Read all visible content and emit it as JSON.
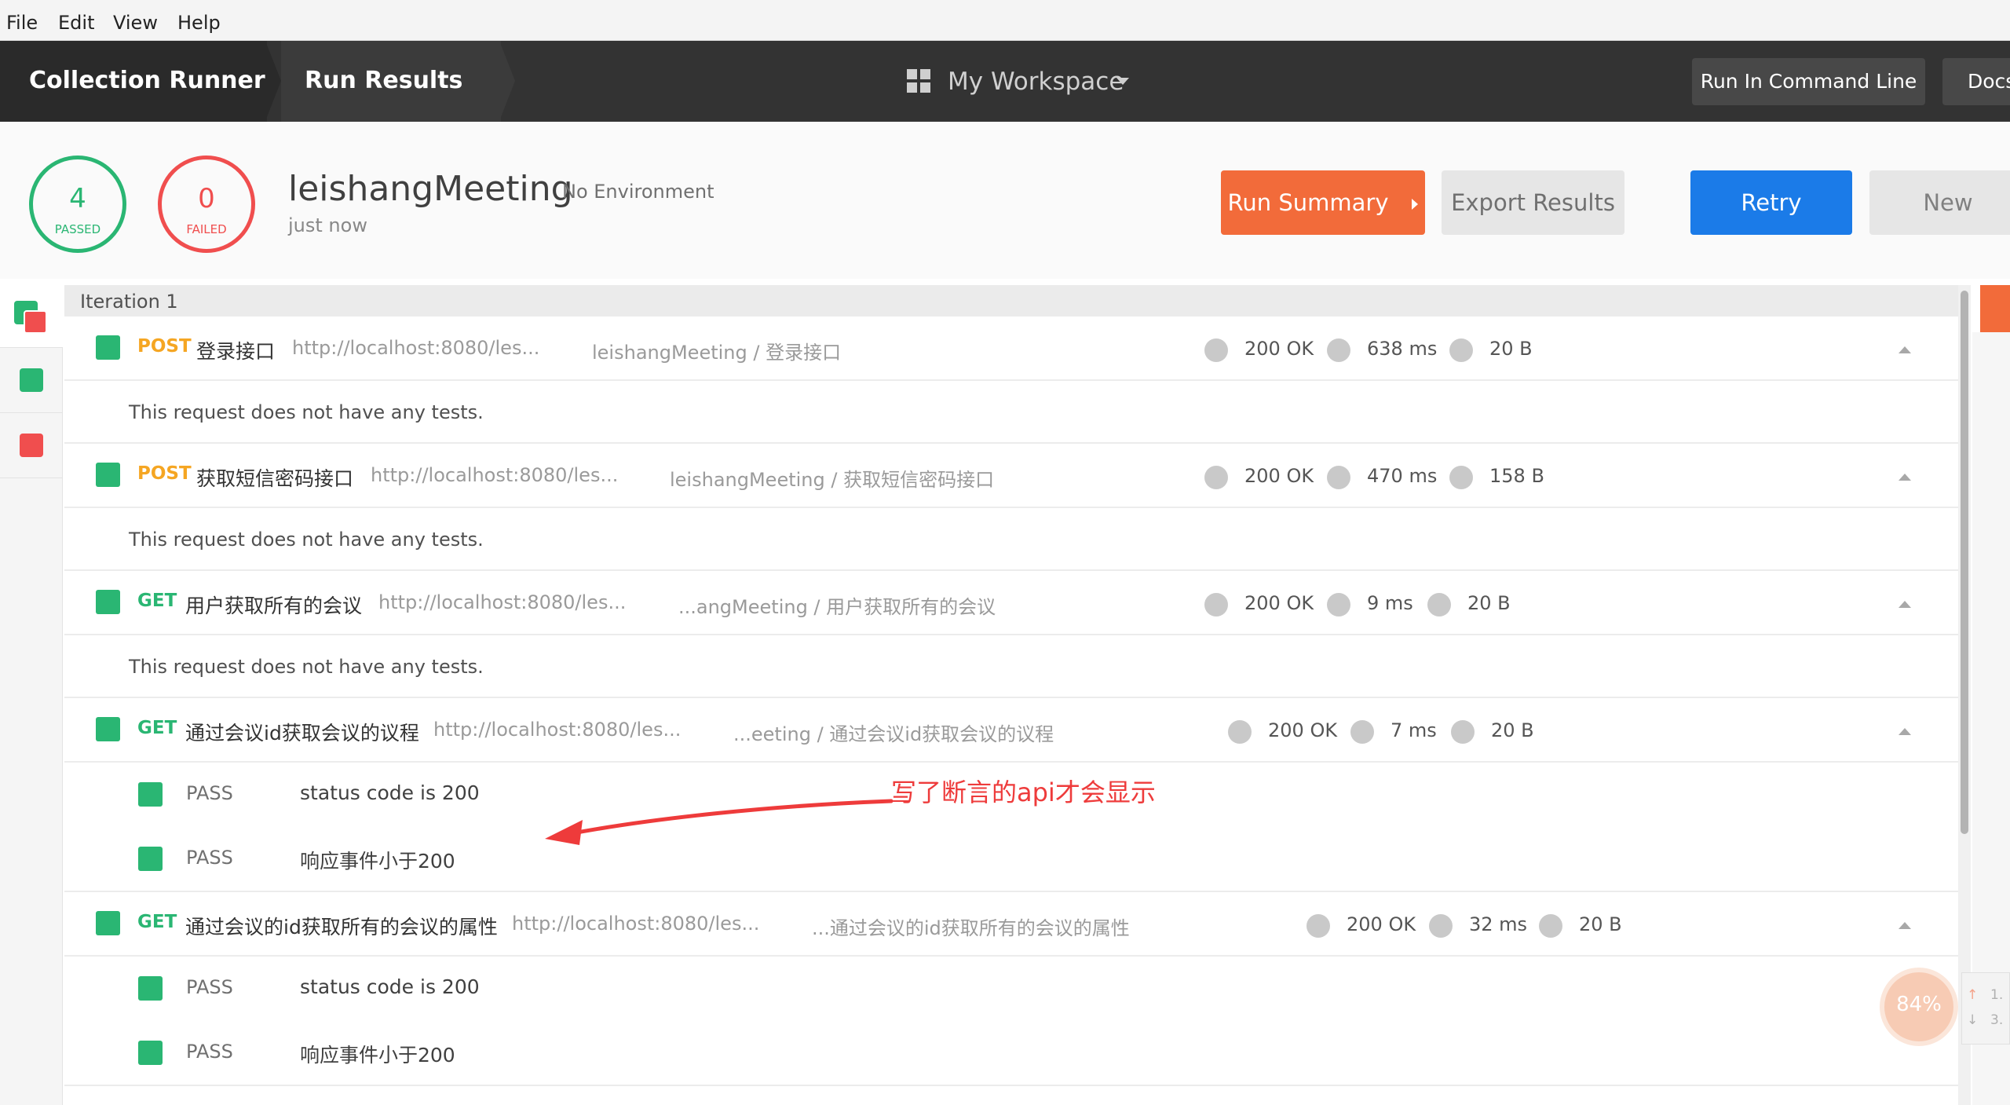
{
  "menu": [
    "File",
    "Edit",
    "View",
    "Help"
  ],
  "header": {
    "crumbs": [
      "Collection Runner",
      "Run Results"
    ],
    "workspace": "My Workspace",
    "buttons": [
      "Run In Command Line",
      "Docs"
    ]
  },
  "summary": {
    "passed_count": "4",
    "passed_label": "PASSED",
    "failed_count": "0",
    "failed_label": "FAILED",
    "collection": "leishangMeeting",
    "environment": "No Environment",
    "time": "just now",
    "buttons": {
      "run_summary": "Run Summary",
      "export": "Export Results",
      "retry": "Retry",
      "new": "New"
    }
  },
  "iteration_label": "Iteration 1",
  "requests": [
    {
      "method": "POST",
      "name": "登录接口",
      "url": "http://localhost:8080/les...",
      "path": "leishangMeeting / 登录接口",
      "status": "200 OK",
      "time": "638 ms",
      "size": "20 B"
    },
    {
      "method": "POST",
      "name": "获取短信密码接口",
      "url": "http://localhost:8080/les...",
      "path": "leishangMeeting / 获取短信密码接口",
      "status": "200 OK",
      "time": "470 ms",
      "size": "158 B"
    },
    {
      "method": "GET",
      "name": "用户获取所有的会议",
      "url": "http://localhost:8080/les...",
      "path": "...angMeeting / 用户获取所有的会议",
      "status": "200 OK",
      "time": "9 ms",
      "size": "20 B"
    },
    {
      "method": "GET",
      "name": "通过会议id获取会议的议程",
      "url": "http://localhost:8080/les...",
      "path": "...eeting / 通过会议id获取会议的议程",
      "status": "200 OK",
      "time": "7 ms",
      "size": "20 B"
    },
    {
      "method": "GET",
      "name": "通过会议的id获取所有的会议的属性",
      "url": "http://localhost:8080/les...",
      "path": "...通过会议的id获取所有的会议的属性",
      "status": "200 OK",
      "time": "32 ms",
      "size": "20 B"
    }
  ],
  "no_tests_msg": "This request does not have any tests.",
  "tests": [
    {
      "status": "PASS",
      "name": "status code is 200"
    },
    {
      "status": "PASS",
      "name": "响应事件小于200"
    }
  ],
  "annotation": "写了断言的api才会显示",
  "widget": {
    "percent": "84%",
    "line1": "1.",
    "line2": "3."
  },
  "colors": {
    "passed": "#2ab673",
    "failed": "#f04e4e",
    "orange": "#f26b3a",
    "blue": "#1b7be8",
    "post": "#f5a623",
    "get": "#2ab673"
  }
}
